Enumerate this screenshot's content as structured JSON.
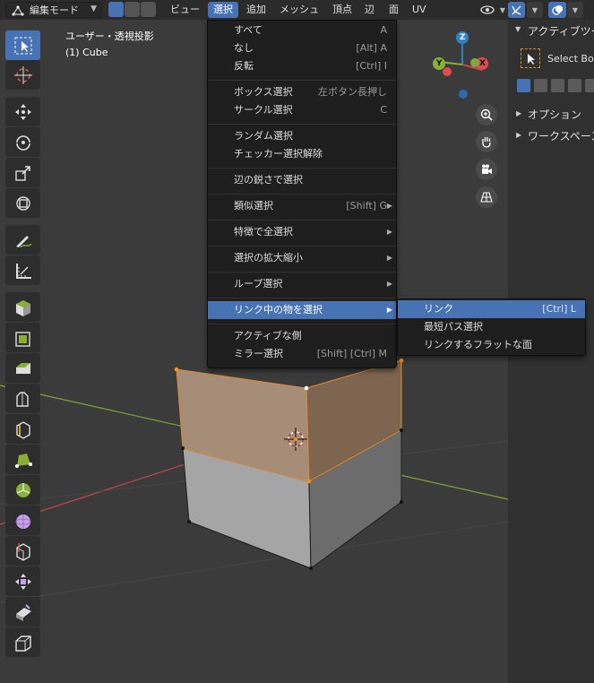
{
  "header": {
    "mode_label": "編集モード",
    "menus": [
      "ビュー",
      "選択",
      "追加",
      "メッシュ",
      "頂点",
      "辺",
      "面",
      "UV"
    ],
    "active_menu": "選択"
  },
  "viewport": {
    "view_name": "ユーザー・透視投影",
    "object_name": "(1) Cube",
    "gizmo": {
      "x": "X",
      "y": "Y",
      "z": "Z"
    }
  },
  "npanel": {
    "active_tool_header": "アクティブツール",
    "tool_name": "Select Box",
    "options": "オプション",
    "workspace": "ワークスペース"
  },
  "select_menu": {
    "items": [
      {
        "label": "すべて",
        "shortcut": "A"
      },
      {
        "label": "なし",
        "shortcut": "[Alt] A"
      },
      {
        "label": "反転",
        "shortcut": "[Ctrl] I"
      },
      {
        "label": "ボックス選択",
        "shortcut": "左ボタン長押し"
      },
      {
        "label": "サークル選択",
        "shortcut": "C"
      },
      {
        "label": "ランダム選択",
        "shortcut": ""
      },
      {
        "label": "チェッカー選択解除",
        "shortcut": ""
      },
      {
        "label": "辺の鋭さで選択",
        "shortcut": ""
      },
      {
        "label": "類似選択",
        "shortcut": "[Shift] G"
      },
      {
        "label": "特徴で全選択",
        "shortcut": ""
      },
      {
        "label": "選択の拡大縮小",
        "shortcut": ""
      },
      {
        "label": "ループ選択",
        "shortcut": ""
      },
      {
        "label": "リンク中の物を選択",
        "shortcut": ""
      },
      {
        "label": "アクティブな側",
        "shortcut": ""
      },
      {
        "label": "ミラー選択",
        "shortcut": "[Shift] [Ctrl] M"
      }
    ]
  },
  "select_linked_submenu": {
    "items": [
      {
        "label": "リンク",
        "shortcut": "[Ctrl] L"
      },
      {
        "label": "最短パス選択",
        "shortcut": ""
      },
      {
        "label": "リンクするフラットな面",
        "shortcut": ""
      }
    ]
  },
  "colors": {
    "accent": "#4772b3",
    "menu_bg": "#1e1e1e",
    "selected_face": "#a58d78",
    "x_axis": "#c8464b",
    "y_axis": "#88b035"
  }
}
